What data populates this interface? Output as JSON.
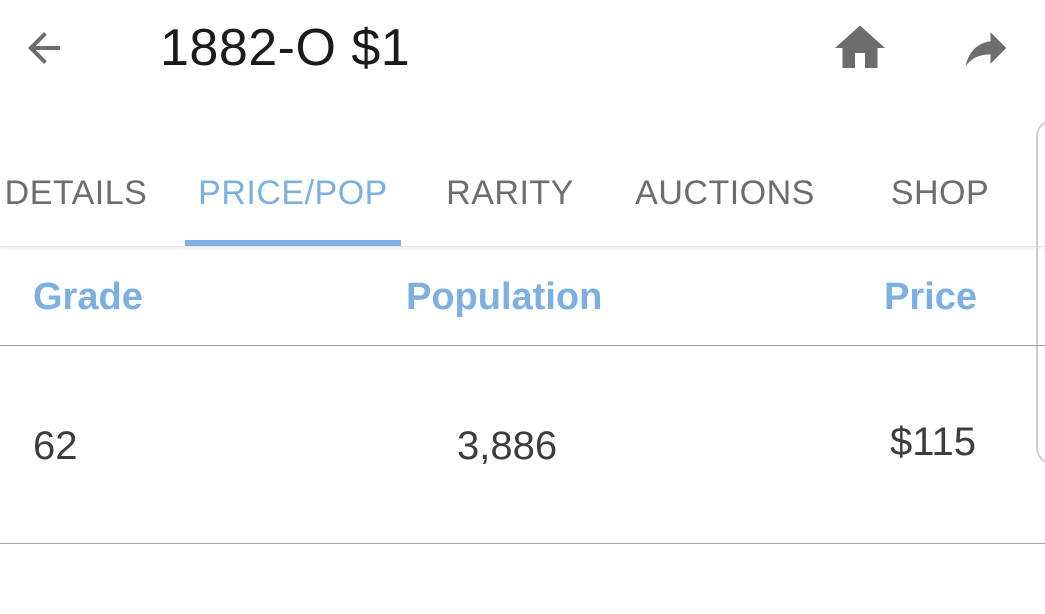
{
  "header": {
    "title": "1882-O $1",
    "icons": {
      "back": "arrow-left-icon",
      "home": "home-icon",
      "share": "share-icon"
    }
  },
  "tabs": [
    {
      "label": "DETAILS"
    },
    {
      "label": "PRICE/POP",
      "active": true
    },
    {
      "label": "RARITY"
    },
    {
      "label": "AUCTIONS"
    },
    {
      "label": "SHOP"
    }
  ],
  "table": {
    "columns": [
      "Grade",
      "Population",
      "Price"
    ],
    "rows": [
      [
        "62",
        "3,886",
        "$115"
      ]
    ]
  },
  "colors": {
    "accent": "#7cb0e2",
    "icon": "#6d6d6d",
    "text": "#1b1b1b"
  }
}
